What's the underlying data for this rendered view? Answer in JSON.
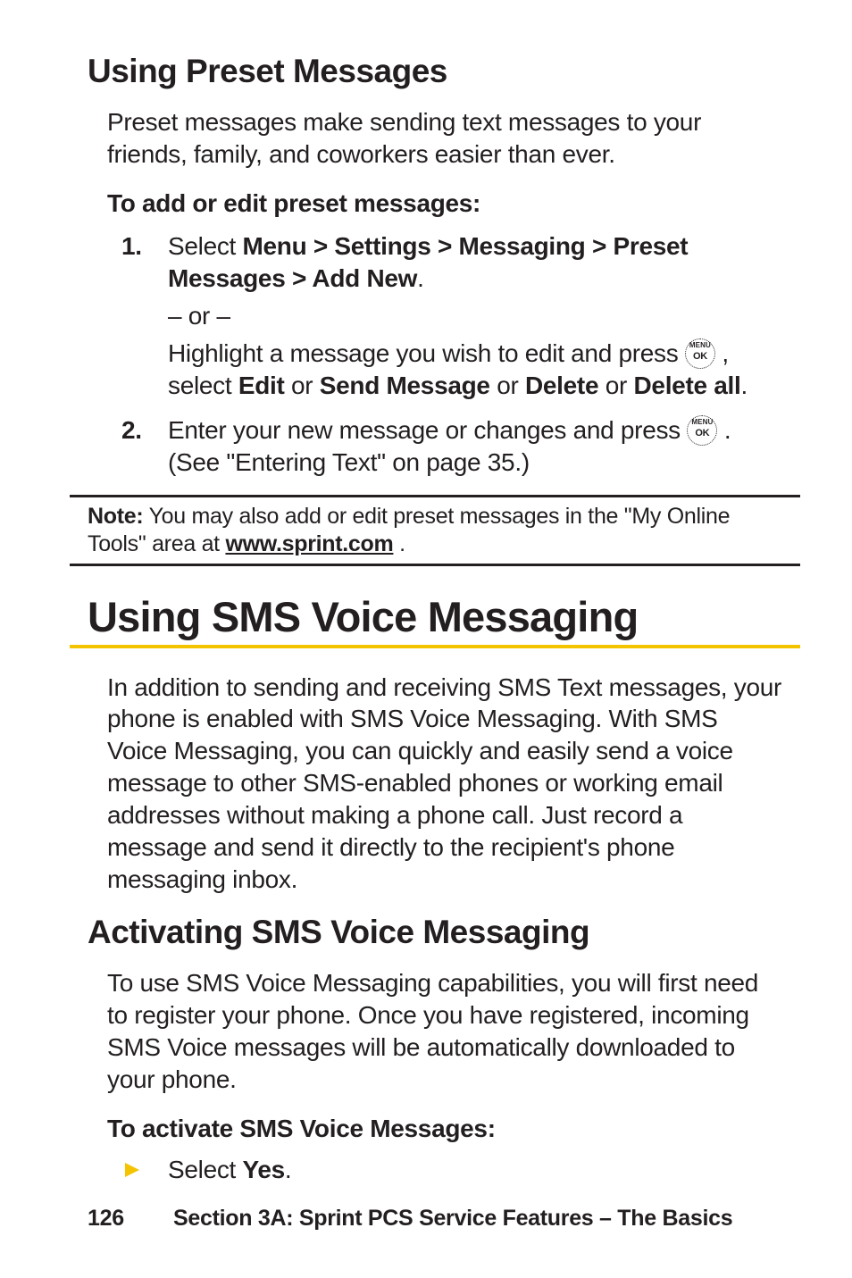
{
  "section1": {
    "heading": "Using Preset Messages",
    "intro": "Preset messages make sending text messages to your friends, family, and coworkers easier than ever.",
    "lead": "To add or edit preset messages:",
    "steps": {
      "s1_num": "1.",
      "s1_prefix": "Select ",
      "s1_bold": "Menu > Settings > Messaging > Preset Messages > Add New",
      "s1_suffix": ".",
      "or": "– or –",
      "s1b_prefix": "Highlight a message you wish to edit and press ",
      "s1b_mid": " , select ",
      "s1b_b1": "Edit",
      "s1b_or1": " or ",
      "s1b_b2": "Send Message",
      "s1b_or2": " or ",
      "s1b_b3": "Delete",
      "s1b_or3": " or ",
      "s1b_b4": "Delete all",
      "s1b_suffix": ".",
      "s2_num": "2.",
      "s2_prefix": "Enter your new message or changes and press ",
      "s2_suffix": " . (See \"Entering Text\" on page 35.)"
    }
  },
  "note": {
    "label": "Note:",
    "text_before": " You may also add or edit preset messages in the \"My Online Tools\" area at ",
    "link": "www.sprint.com",
    "text_after": " ."
  },
  "section2": {
    "heading": "Using SMS Voice Messaging",
    "intro": "In addition to sending and receiving SMS Text messages, your phone is enabled with SMS Voice Messaging. With SMS Voice Messaging, you can quickly and easily send a voice message to other SMS-enabled phones or working email addresses without making a phone call. Just record a message and send it directly to the recipient's phone messaging inbox."
  },
  "section3": {
    "heading": "Activating SMS Voice Messaging",
    "intro": "To use SMS Voice Messaging capabilities, you will first need to register your phone. Once you have registered, incoming SMS Voice messages will be automatically downloaded to your phone.",
    "lead": "To activate SMS Voice Messages:",
    "bullet_prefix": "Select ",
    "bullet_bold": "Yes",
    "bullet_suffix": "."
  },
  "footer": {
    "page": "126",
    "title": "Section 3A: Sprint PCS Service Features – The Basics"
  },
  "icons": {
    "menu": "MENU",
    "ok": "OK"
  }
}
